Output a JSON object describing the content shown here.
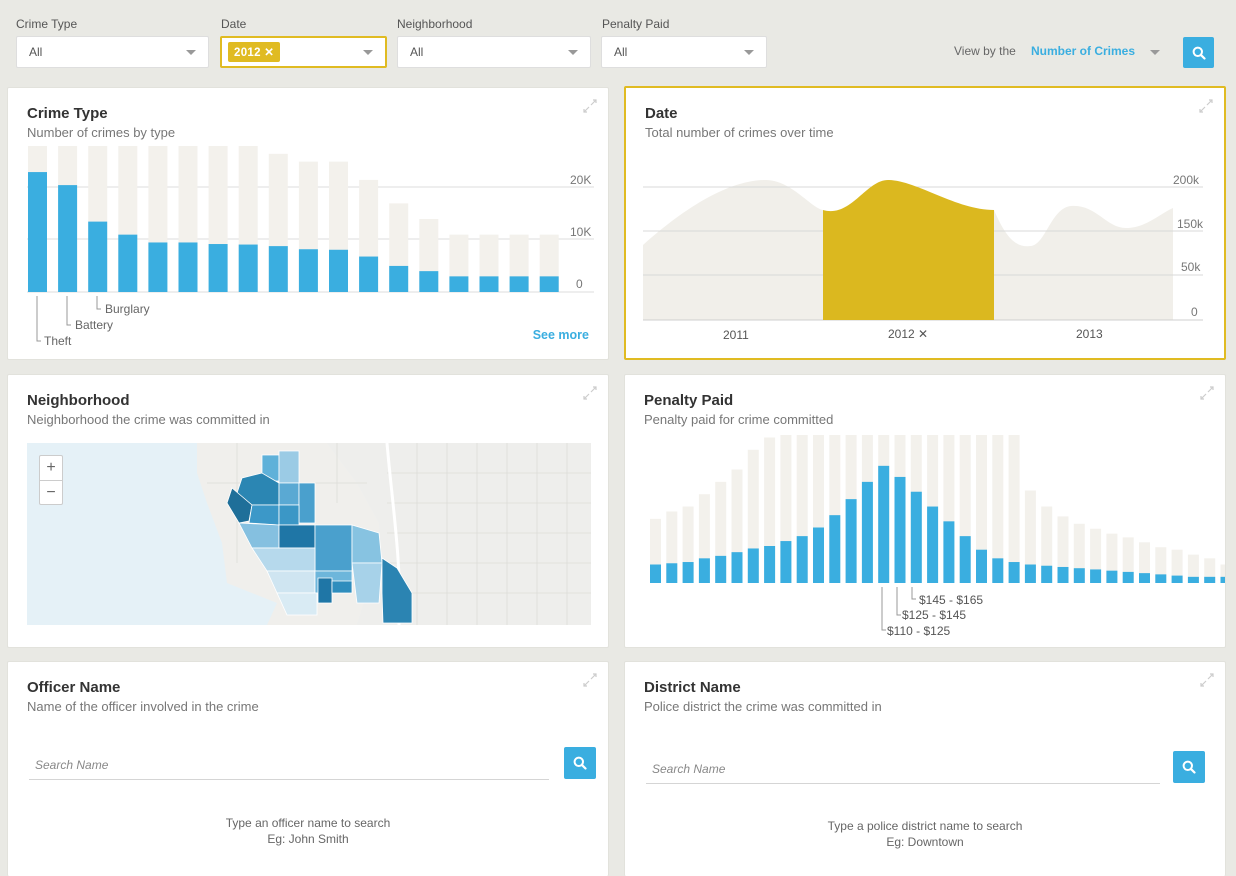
{
  "filters": {
    "crime_type": {
      "label": "Crime Type",
      "value": "All"
    },
    "date": {
      "label": "Date",
      "chip": "2012 ✕"
    },
    "neighborhood": {
      "label": "Neighborhood",
      "value": "All"
    },
    "penalty_paid": {
      "label": "Penalty Paid",
      "value": "All"
    },
    "view_by_label": "View by the",
    "view_by_value": "Number of Crimes"
  },
  "crime_type_panel": {
    "title": "Crime Type",
    "subtitle": "Number of crimes by type",
    "see_more": "See more",
    "annotations": [
      "Burglary",
      "Battery",
      "Theft"
    ]
  },
  "date_panel": {
    "title": "Date",
    "subtitle": "Total number of crimes over time"
  },
  "neighborhood_panel": {
    "title": "Neighborhood",
    "subtitle": "Neighborhood the crime was committed in",
    "zoom_in": "+",
    "zoom_out": "−"
  },
  "penalty_panel": {
    "title": "Penalty Paid",
    "subtitle": "Penalty paid for crime committed",
    "annotations": [
      "$145 - $165",
      "$125 - $145",
      "$110 - $125"
    ]
  },
  "officer_panel": {
    "title": "Officer Name",
    "subtitle": "Name of the officer involved in the crime",
    "placeholder": "Search Name",
    "hint_line1": "Type an officer name to search",
    "hint_line2": "Eg: John Smith"
  },
  "district_panel": {
    "title": "District Name",
    "subtitle": "Police district the crime was committed in",
    "placeholder": "Search Name",
    "hint_line1": "Type a police district name to search",
    "hint_line2": "Eg: Downtown"
  },
  "colors": {
    "accent": "#3aaee0",
    "highlight": "#e0bb22",
    "background_bar": "#f3f1ec"
  },
  "chart_data": [
    {
      "type": "bar",
      "title": "Crime Type",
      "subtitle": "Number of crimes by type",
      "categories": [
        "Theft",
        "Battery",
        "Burglary",
        "",
        "",
        "",
        "",
        "",
        "",
        "",
        "",
        "",
        "",
        "",
        "",
        "",
        "",
        ""
      ],
      "series": [
        {
          "values": [
            23000,
            20500,
            13500,
            11000,
            9500,
            9500,
            9200,
            9100,
            8800,
            8200,
            8100,
            6800,
            5000,
            4000,
            3000,
            3000,
            3000,
            3000
          ]
        },
        {
          "values": [
            28000,
            28000,
            28000,
            28000,
            28000,
            28000,
            28000,
            28000,
            26500,
            25000,
            25000,
            21500,
            17000,
            14000,
            11000,
            11000,
            11000,
            11000
          ]
        }
      ],
      "yticks": [
        "20K",
        "10K",
        "0"
      ],
      "ylim": [
        0,
        28000
      ]
    },
    {
      "type": "area",
      "title": "Date",
      "subtitle": "Total number of crimes over time",
      "x": [
        "2011",
        "2012 ✕",
        "2013"
      ],
      "yticks": [
        "200k",
        "150k",
        "50k",
        "0"
      ],
      "ylim": [
        0,
        200000
      ],
      "highlight": "2012"
    },
    {
      "type": "bar",
      "title": "Penalty Paid",
      "subtitle": "Penalty paid for crime committed",
      "series": [
        {
          "values": [
            15,
            16,
            17,
            20,
            22,
            25,
            28,
            30,
            34,
            38,
            45,
            55,
            68,
            82,
            95,
            86,
            74,
            62,
            50,
            38,
            27,
            20,
            17,
            15,
            14,
            13,
            12,
            11,
            10,
            9,
            8,
            7,
            6,
            5,
            5,
            5
          ]
        },
        {
          "values": [
            52,
            58,
            62,
            72,
            82,
            92,
            108,
            118,
            120,
            120,
            120,
            120,
            120,
            120,
            120,
            120,
            120,
            120,
            120,
            120,
            120,
            120,
            120,
            75,
            62,
            54,
            48,
            44,
            40,
            37,
            33,
            29,
            27,
            23,
            20,
            15
          ]
        }
      ],
      "annotations": [
        "$145 - $165",
        "$125 - $145",
        "$110 - $125"
      ]
    }
  ]
}
